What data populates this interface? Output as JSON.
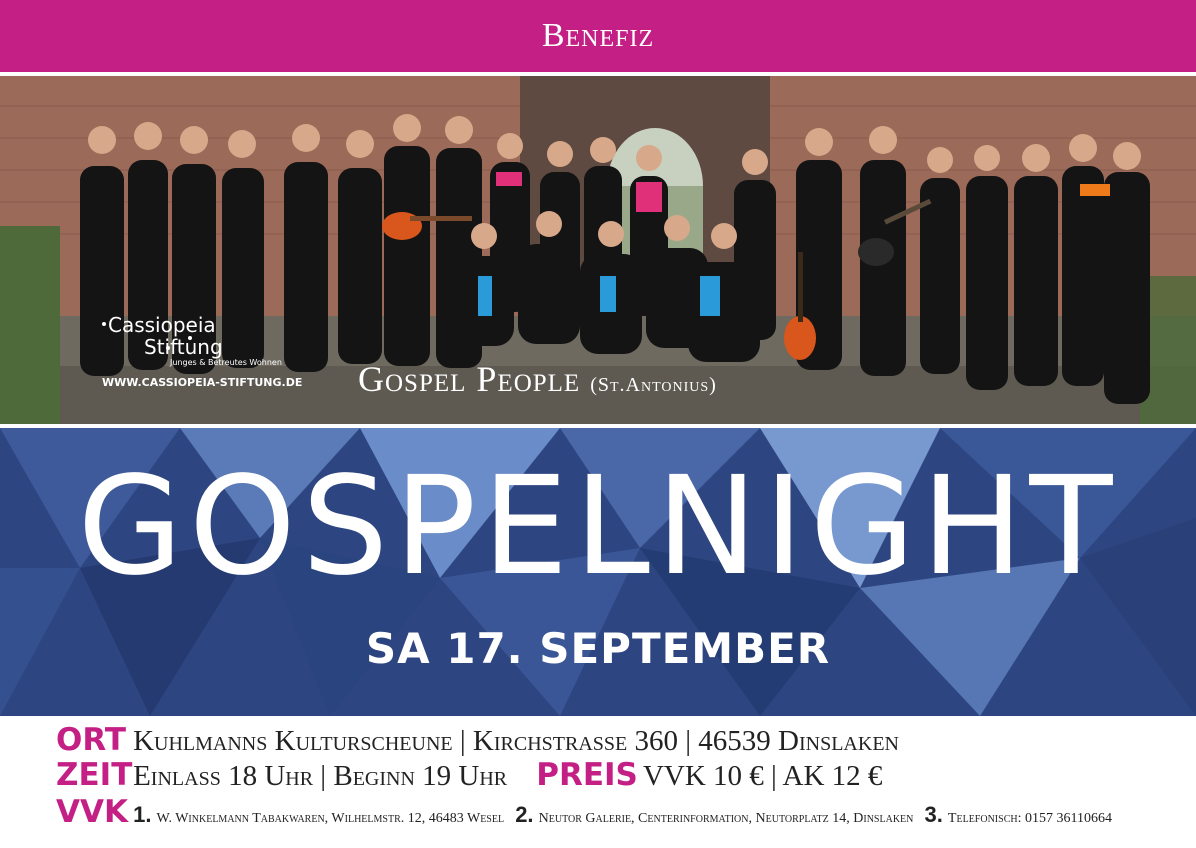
{
  "header": {
    "title": "Benefiz"
  },
  "photo": {
    "logo_name_1": "Cassiopeia",
    "logo_name_2": "Stiftung",
    "logo_tagline": "Junges & Betreutes Wohnen",
    "logo_url": "WWW.CASSIOPEIA-STIFTUNG.DE",
    "choir_name": "Gospel People",
    "choir_sub": "(St.Antonius)"
  },
  "event": {
    "title": "GOSPELNIGHT",
    "date": "SA 17. SEPTEMBER"
  },
  "info": {
    "ort_label": "ORT",
    "ort_value": "Kuhlmanns Kulturscheune | Kirchstraße 360 | 46539 Dinslaken",
    "zeit_label": "ZEIT",
    "zeit_value": "Einlass 18 Uhr | Beginn 19 Uhr",
    "preis_label": "PREIS",
    "preis_value": "VVK 10 € | AK 12 €",
    "vvk_label": "VVK",
    "vvk_items": [
      {
        "num": "1.",
        "text": "W. Winkelmann Tabakwaren, Wilhelmstr. 12, 46483 Wesel"
      },
      {
        "num": "2.",
        "text": "Neutor Galerie, Centerinformation, Neutorplatz 14, Dinslaken"
      },
      {
        "num": "3.",
        "text": "Telefonisch: 0157 36110664"
      }
    ]
  },
  "colors": {
    "accent": "#c41f84",
    "blue": "#2d4580",
    "text": "#222222"
  }
}
